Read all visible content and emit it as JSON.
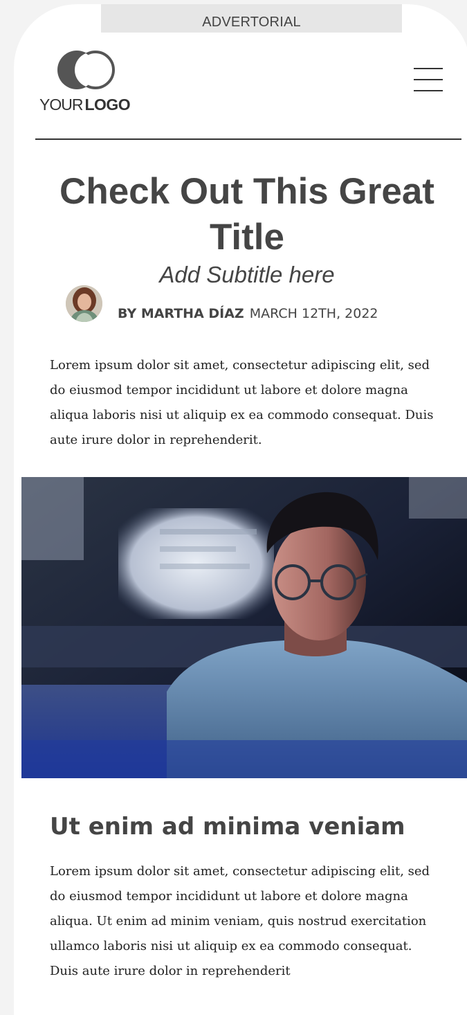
{
  "banner": {
    "label": "ADVERTORIAL"
  },
  "logo": {
    "text_light": "YOUR",
    "text_bold": "LOGO",
    "icon": "overlapping-circles-logo-icon"
  },
  "header": {
    "menu_icon": "hamburger-menu-icon"
  },
  "article": {
    "title": "Check Out This Great Title",
    "subtitle": "Add Subtitle here",
    "author": "BY MARTHA DÍAZ",
    "date": "MARCH 12TH, 2022",
    "intro": "Lorem ipsum dolor sit amet, consectetur adipiscing elit, sed do eiusmod tempor incididunt ut labore et dolore magna aliqua laboris nisi ut aliquip ex ea commodo consequat. Duis aute irure dolor in reprehenderit.",
    "section_heading": "Ut enim ad minima veniam",
    "section_body": "Lorem ipsum dolor sit amet, consectetur adipiscing elit, sed do eiusmod tempor incididunt ut labore et dolore magna aliqua. Ut enim ad minim veniam, quis nostrud exercitation ullamco laboris nisi ut aliquip ex ea commodo consequat. Duis aute irure dolor in reprehenderit"
  },
  "colors": {
    "page_background": "#f3f3f3",
    "card": "#ffffff",
    "banner_background": "#e6e6e6",
    "heading_text": "#454545",
    "body_text": "#222222"
  }
}
